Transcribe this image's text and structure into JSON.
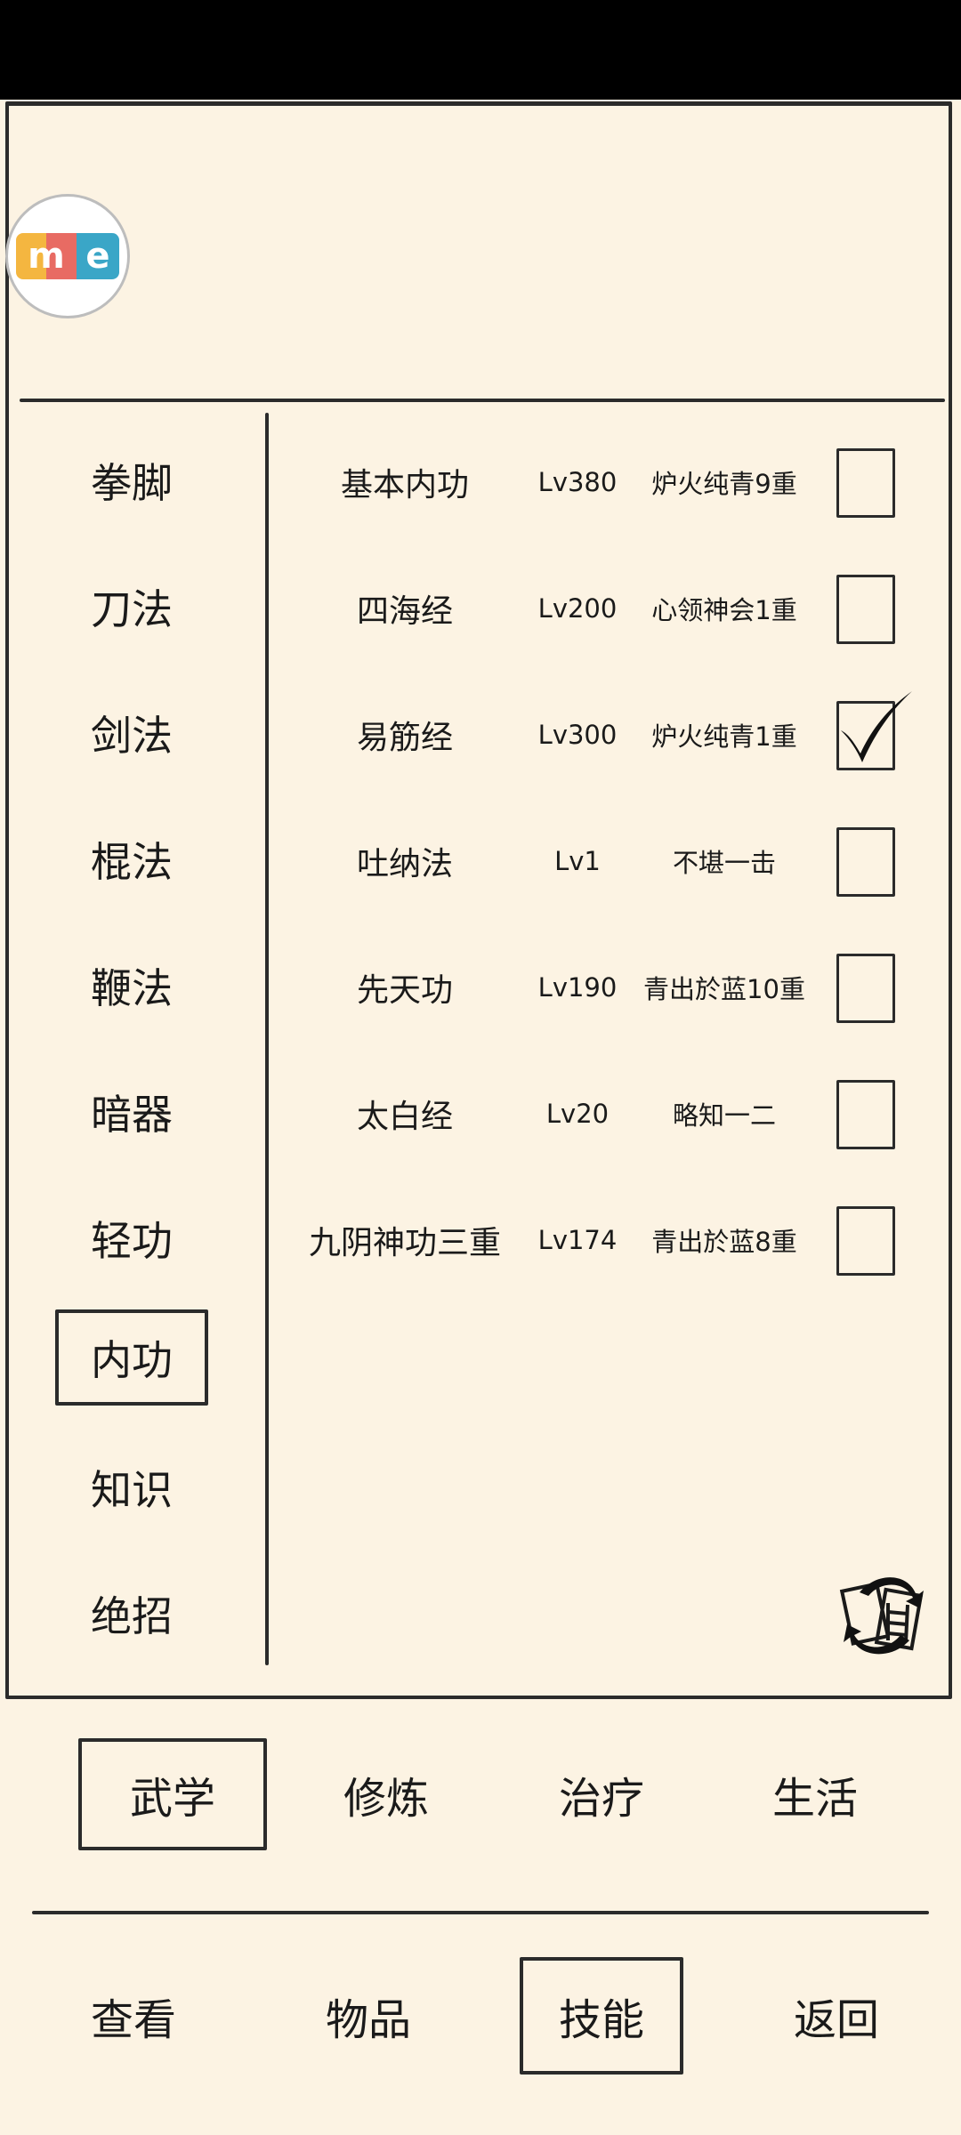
{
  "logo": {
    "text_m": "m",
    "text_e": "e"
  },
  "categories": [
    "拳脚",
    "刀法",
    "剑法",
    "棍法",
    "鞭法",
    "暗器",
    "轻功",
    "内功",
    "知识",
    "绝招"
  ],
  "selected_category": "内功",
  "skills": [
    {
      "name": "基本内功",
      "level": "Lv380",
      "rank": "炉火纯青9重",
      "checked": false
    },
    {
      "name": "四海经",
      "level": "Lv200",
      "rank": "心领神会1重",
      "checked": false
    },
    {
      "name": "易筋经",
      "level": "Lv300",
      "rank": "炉火纯青1重",
      "checked": true
    },
    {
      "name": "吐纳法",
      "level": "Lv1",
      "rank": "不堪一击",
      "checked": false
    },
    {
      "name": "先天功",
      "level": "Lv190",
      "rank": "青出於蓝10重",
      "checked": false
    },
    {
      "name": "太白经",
      "level": "Lv20",
      "rank": "略知一二",
      "checked": false
    },
    {
      "name": "九阴神功三重",
      "level": "Lv174",
      "rank": "青出於蓝8重",
      "checked": false
    }
  ],
  "tabs": [
    "武学",
    "修炼",
    "治疗",
    "生活"
  ],
  "selected_tab": "武学",
  "bottom_nav": [
    "查看",
    "物品",
    "技能",
    "返回"
  ],
  "selected_nav": "技能",
  "icons": {
    "refresh": "refresh-icon",
    "check": "checkmark-icon"
  }
}
